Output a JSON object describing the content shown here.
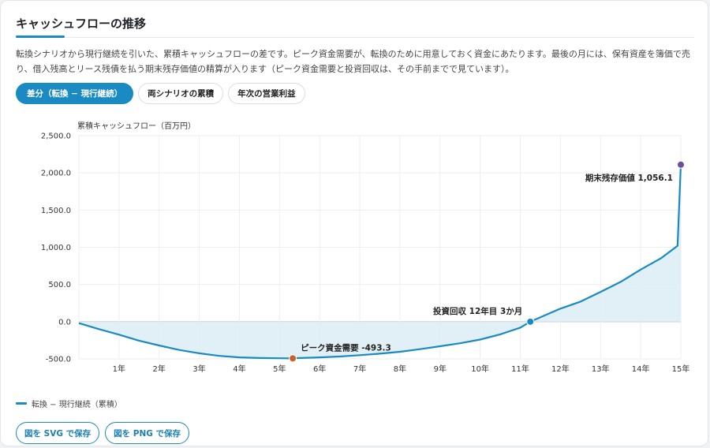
{
  "panel": {
    "title": "キャッシュフローの推移",
    "description": "転換シナリオから現行継続を引いた、累積キャッシュフローの差です。ピーク資金需要が、転換のために用意しておく資金にあたります。最後の月には、保有資産を簿価で売り、借入残高とリース残債を払う期末残存価値の精算が入ります（ピーク資金需要と投資回収は、その手前までで見ています）。"
  },
  "tabs": [
    {
      "label": "差分（転換 − 現行継続）",
      "active": true
    },
    {
      "label": "両シナリオの累積",
      "active": false
    },
    {
      "label": "年次の営業利益",
      "active": false
    }
  ],
  "legend": {
    "label": "転換 − 現行継続（累積）"
  },
  "buttons": {
    "save_svg": "図を SVG で保存",
    "save_png": "図を PNG で保存"
  },
  "colors": {
    "accent": "#1a8ac3",
    "area": "#dcedf6",
    "peak_marker": "#c8622a",
    "payback_marker": "#1a8ac3",
    "terminal_marker": "#6a4fa0"
  },
  "chart_data": {
    "type": "area",
    "ylabel": "累積キャッシュフロー（百万円）",
    "ylim": [
      -500,
      2500
    ],
    "xlim": [
      0,
      15
    ],
    "yticks": [
      2500,
      2000,
      1500,
      1000,
      500,
      0,
      -500
    ],
    "ytick_labels": [
      "2,500.0",
      "2,000.0",
      "1,500.0",
      "1,000.0",
      "500.0",
      "0.0",
      "-500.0"
    ],
    "xticks": [
      1,
      2,
      3,
      4,
      5,
      6,
      7,
      8,
      9,
      10,
      11,
      12,
      13,
      14,
      15
    ],
    "xtick_labels": [
      "1年",
      "2年",
      "3年",
      "4年",
      "5年",
      "6年",
      "7年",
      "8年",
      "9年",
      "10年",
      "11年",
      "12年",
      "13年",
      "14年",
      "15年"
    ],
    "grid": true,
    "series": [
      {
        "name": "転換 − 現行継続（累積）",
        "x": [
          0,
          0.5,
          1,
          1.5,
          2,
          2.5,
          3,
          3.5,
          4,
          4.5,
          5,
          5.33,
          5.5,
          6,
          6.5,
          7,
          7.5,
          8,
          8.5,
          9,
          9.5,
          10,
          10.5,
          11,
          11.25,
          11.5,
          12,
          12.5,
          13,
          13.5,
          14,
          14.5,
          14.92,
          15
        ],
        "values": [
          -20,
          -100,
          -175,
          -255,
          -320,
          -380,
          -425,
          -460,
          -480,
          -488,
          -492,
          -493.3,
          -488,
          -480,
          -468,
          -450,
          -430,
          -405,
          -370,
          -330,
          -290,
          -240,
          -170,
          -80,
          0,
          60,
          175,
          270,
          400,
          535,
          700,
          850,
          1020,
          2110
        ]
      }
    ],
    "annotations": [
      {
        "label": "ピーク資金需要 -493.3",
        "x": 5.33,
        "y": -493.3
      },
      {
        "label": "投資回収 12年目 3か月",
        "x": 11.25,
        "y": 0
      },
      {
        "label": "期末残存価値 1,056.1",
        "x": 15,
        "y": 2110
      }
    ]
  }
}
